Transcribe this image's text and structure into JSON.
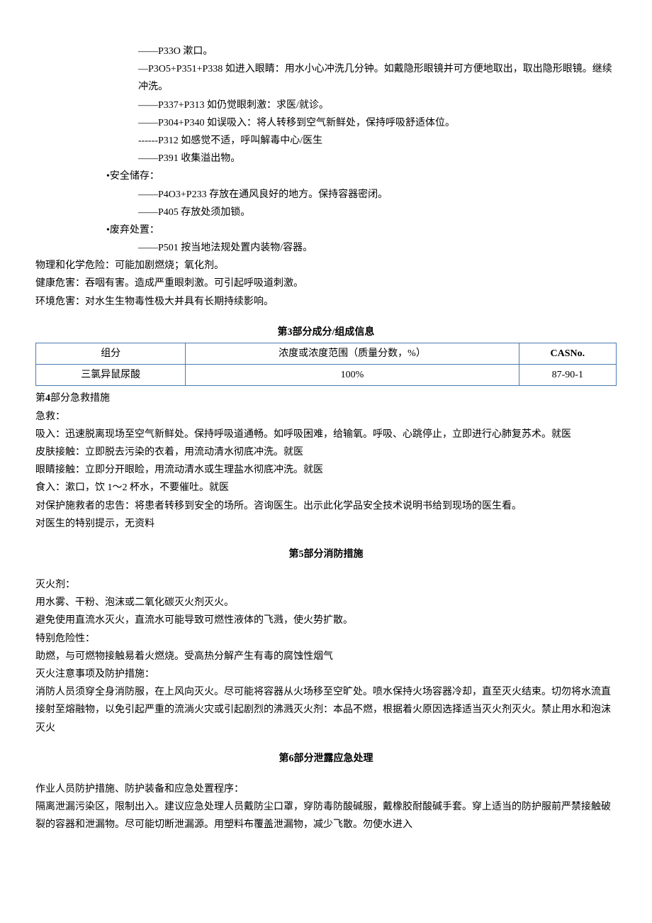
{
  "precautions": {
    "p33o": "——P33O 漱口。",
    "p305": "—P3O5+P351+P338 如进入眼睛：用水小心冲洗几分钟。如戴隐形眼镜并可方便地取出，取出隐形眼镜。继续冲洗。",
    "p337": "——P337+P313 如仍觉眼刺激：求医/就诊。",
    "p304": "——P304+P340 如误吸入：将人转移到空气新鲜处，保持呼吸舒适体位。",
    "p312": "------P312 如感觉不适，呼叫解毒中心/医生",
    "p391": "——P391 收集溢出物。"
  },
  "storage": {
    "title": "•安全储存：",
    "p403": "——P4O3+P233 存放在通风良好的地方。保持容器密闭。",
    "p405": "——P405 存放处须加锁。"
  },
  "disposal": {
    "title": "•废弃处置：",
    "p501": "——P501 按当地法规处置内装物/容器。"
  },
  "hazards": {
    "physical": "物理和化学危险：可能加剧燃烧；氧化剂。",
    "health": "健康危害：吞咽有害。造成严重眼刺激。可引起呼吸道刺激。",
    "env": "环境危害：对水生生物毒性极大并具有长期持续影响。"
  },
  "section3": {
    "title_prefix": "第",
    "title_num": "3",
    "title_suffix": "部分成分/组成信息",
    "table": {
      "headers": {
        "component": "组分",
        "concentration": "浓度或浓度范围（质量分数，%）",
        "cas": "CASNo."
      },
      "row": {
        "component": "三氯异鼠尿酸",
        "concentration": "100%",
        "cas": "87-90-1"
      }
    }
  },
  "section4": {
    "title_prefix": "第",
    "title_num": "4",
    "title_suffix": "部分急救措施",
    "lines": {
      "l1": "急救：",
      "l2": "吸入：迅速脱离现场至空气新鲜处。保持呼吸道通畅。如呼吸困难，给输氧。呼吸、心跳停止，立即进行心肺复苏术。就医",
      "l3": "皮肤接触：立即脱去污染的衣着，用流动清水彻底冲洗。就医",
      "l4": "眼睛接触：立即分开眼睑，用流动清水或生理盐水彻底冲洗。就医",
      "l5": "食入：漱口，饮 1～2 杯水，不要催吐。就医",
      "l6": "对保护施救者的忠告：将患者转移到安全的场所。咨询医生。出示此化学品安全技术说明书给到现场的医生看。",
      "l7": "对医生的特别提示，无资料"
    }
  },
  "section5": {
    "title_prefix": "第",
    "title_num": "5",
    "title_suffix": "部分消防措施",
    "lines": {
      "l1": "灭火剂：",
      "l2": "用水雾、干粉、泡沫或二氧化碳灭火剂灭火。",
      "l3": "避免使用直流水灭火，直流水可能导致可燃性液体的飞溅，使火势扩散。",
      "l4": "特别危险性：",
      "l5": "助燃，与可燃物接触易着火燃烧。受高热分解产生有毒的腐蚀性烟气",
      "l6": "灭火注意事项及防护措施：",
      "l7": "消防人员须穿全身消防服，在上风向灭火。尽可能将容器从火场移至空旷处。喷水保持火场容器冷却，直至灭火结束。切勿将水流直接射至熔融物，以免引起严重的流淌火灾或引起剧烈的沸溅灭火剂：本品不燃，根据着火原因选择适当灭火剂灭火。禁止用水和泡沫灭火"
    }
  },
  "section6": {
    "title_prefix": "第",
    "title_num": "6",
    "title_suffix": "部分泄露应急处理",
    "lines": {
      "l1": "作业人员防护措施、防护装备和应急处置程序：",
      "l2": "隔离泄漏污染区，限制出入。建议应急处理人员戴防尘口罩，穿防毒防酸碱服，戴橡胶耐酸碱手套。穿上适当的防护服前严禁接触破裂的容器和泄漏物。尽可能切断泄漏源。用塑料布覆盖泄漏物，减少飞散。勿使水进入"
    }
  }
}
